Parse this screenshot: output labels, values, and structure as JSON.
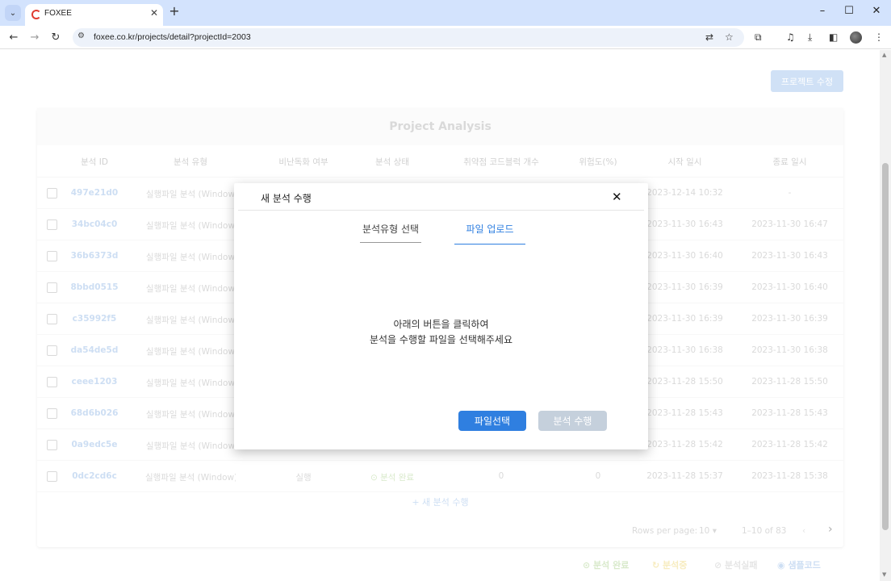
{
  "browser": {
    "tab_title": "FOXEE",
    "url": "foxee.co.kr/projects/detail?projectId=2003"
  },
  "page": {
    "edit_button": "프로젝트 수정",
    "card_title": "Project Analysis",
    "columns": [
      "분석 ID",
      "분석 유형",
      "비난독화 여부",
      "분석 상태",
      "취약점 코드블럭 개수",
      "위험도(%)",
      "시작 일시",
      "종료 일시"
    ],
    "rows": [
      {
        "id": "497e21d0",
        "type": "실행파일 분석 (Window",
        "start": "2023-12-14 10:32",
        "end": "-"
      },
      {
        "id": "34bc04c0",
        "type": "실행파일 분석 (Window",
        "start": "2023-11-30 16:43",
        "end": "2023-11-30 16:47"
      },
      {
        "id": "36b6373d",
        "type": "실행파일 분석 (Window",
        "start": "2023-11-30 16:40",
        "end": "2023-11-30 16:43"
      },
      {
        "id": "8bbd0515",
        "type": "실행파일 분석 (Window",
        "start": "2023-11-30 16:39",
        "end": "2023-11-30 16:40"
      },
      {
        "id": "c35992f5",
        "type": "실행파일 분석 (Window",
        "start": "2023-11-30 16:39",
        "end": "2023-11-30 16:39"
      },
      {
        "id": "da54de5d",
        "type": "실행파일 분석 (Window",
        "start": "2023-11-30 16:38",
        "end": "2023-11-30 16:38"
      },
      {
        "id": "ceee1203",
        "type": "실행파일 분석 (Window",
        "start": "2023-11-28 15:50",
        "end": "2023-11-28 15:50"
      },
      {
        "id": "68d6b026",
        "type": "실행파일 분석 (Window",
        "start": "2023-11-28 15:43",
        "end": "2023-11-28 15:43"
      },
      {
        "id": "0a9edc5e",
        "type": "실행파일 분석 (Window",
        "start": "2023-11-28 15:42",
        "end": "2023-11-28 15:42"
      },
      {
        "id": "0dc2cd6c",
        "type": "실행파일 분석 (Window)",
        "deobf": "실행",
        "status": "분석 완료",
        "vuln": "0",
        "risk": "0",
        "start": "2023-11-28 15:37",
        "end": "2023-11-28 15:38"
      }
    ],
    "new_analysis_link": "+ 새 분석 수행",
    "rows_per_page_label": "Rows per page:",
    "rows_per_page_value": "10",
    "range_text": "1–10 of 83",
    "legend": {
      "done": "분석 완료",
      "running": "분석중",
      "failed": "분석실패",
      "sample": "샘플코드"
    },
    "colors": {
      "done": "#b8d89f",
      "running": "#f0dc8a",
      "failed": "#d0d0d0",
      "sample": "#a5c4ea"
    }
  },
  "modal": {
    "title": "새 분석 수행",
    "step1": "분석유형 선택",
    "step2": "파일 업로드",
    "instruction_line1": "아래의 버튼을 클릭하여",
    "instruction_line2": "분석을 수행할 파일을 선택해주세요",
    "file_button": "파일선택",
    "run_button": "분석 수행",
    "primary_color": "#2f7fe0"
  }
}
